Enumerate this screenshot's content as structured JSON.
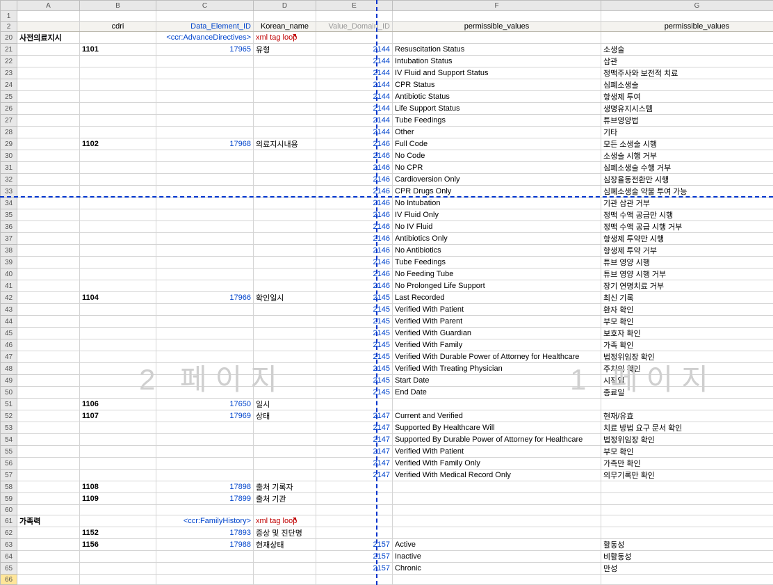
{
  "columns": [
    "A",
    "B",
    "C",
    "D",
    "E",
    "F",
    "G"
  ],
  "header": {
    "B": "cdri",
    "C": "Data_Element_ID",
    "D": "Korean_name",
    "E": "Value_Domain_ID",
    "F": "permissible_values",
    "G": "permissible_values"
  },
  "section1": {
    "A": "사전의료지시",
    "C": "<ccr:AdvanceDirectives>",
    "D": "xml tag loop"
  },
  "section2": {
    "A": "가족력",
    "C": "<ccr:FamilyHistory>",
    "D": "xml tag loop"
  },
  "watermark_left": "2 페이지",
  "watermark_right": "1 페이지",
  "rows": [
    {
      "n": 1
    },
    {
      "n": 2,
      "hdr": true
    },
    {
      "n": 20,
      "section": 1
    },
    {
      "n": 21,
      "B": "1101",
      "C": "17965",
      "D": "유형",
      "E": "2144",
      "F": "Resuscitation Status",
      "G": "소생술"
    },
    {
      "n": 22,
      "E": "2144",
      "F": "Intubation Status",
      "G": "삽관"
    },
    {
      "n": 23,
      "E": "2144",
      "F": "IV Fluid and Support Status",
      "G": "정맥주사와 보전적 치료"
    },
    {
      "n": 24,
      "E": "2144",
      "F": "CPR Status",
      "G": "심폐소생술"
    },
    {
      "n": 25,
      "E": "2144",
      "F": "Antibiotic Status",
      "G": "항생제 투여"
    },
    {
      "n": 26,
      "E": "2144",
      "F": "Life Support Status",
      "G": "생명유지시스템"
    },
    {
      "n": 27,
      "E": "2144",
      "F": "Tube Feedings",
      "G": "튜브영양법"
    },
    {
      "n": 28,
      "E": "2144",
      "F": "Other",
      "G": "기타"
    },
    {
      "n": 29,
      "B": "1102",
      "C": "17968",
      "D": "의료지시내용",
      "E": "2146",
      "F": "Full Code",
      "G": "모든 소생술 시행"
    },
    {
      "n": 30,
      "E": "2146",
      "F": "No Code",
      "G": "소생술 시행 거부"
    },
    {
      "n": 31,
      "E": "2146",
      "F": "No CPR",
      "G": "심폐소생술 수행 거부"
    },
    {
      "n": 32,
      "E": "2146",
      "F": "Cardioversion Only",
      "G": "심장율동전환만 시행"
    },
    {
      "n": 33,
      "E": "2146",
      "F": "CPR Drugs Only",
      "G": "심폐소생술 약물 투여 가능"
    },
    {
      "n": 34,
      "E": "2146",
      "F": "No Intubation",
      "G": "기관 삽관 거부"
    },
    {
      "n": 35,
      "E": "2146",
      "F": "IV Fluid Only",
      "G": "정맥 수액 공급만 시행"
    },
    {
      "n": 36,
      "E": "2146",
      "F": "No IV Fluid",
      "G": "정맥 수액 공급 시행 거부"
    },
    {
      "n": 37,
      "E": "2146",
      "F": "Antibiotics Only",
      "G": "항생제 투약만 시행"
    },
    {
      "n": 38,
      "E": "2146",
      "F": "No Antibiotics",
      "G": "항생제 투약 거부"
    },
    {
      "n": 39,
      "E": "2146",
      "F": "Tube Feedings",
      "G": "튜브 영양 시행"
    },
    {
      "n": 40,
      "E": "2146",
      "F": "No Feeding Tube",
      "G": "튜브 영양 시행 거부"
    },
    {
      "n": 41,
      "E": "2146",
      "F": "No Prolonged Life Support",
      "G": "장기 연명치료 거부"
    },
    {
      "n": 42,
      "B": "1104",
      "C": "17966",
      "D": "확인일시",
      "E": "2145",
      "F": "Last Recorded",
      "G": "최신 기록"
    },
    {
      "n": 43,
      "E": "2145",
      "F": "Verified With Patient",
      "G": "환자 확인"
    },
    {
      "n": 44,
      "E": "2145",
      "F": "Verified With Parent",
      "G": "부모 확인"
    },
    {
      "n": 45,
      "E": "2145",
      "F": "Verified With Guardian",
      "G": "보호자 확인"
    },
    {
      "n": 46,
      "E": "2145",
      "F": "Verified With Family",
      "G": "가족 확인"
    },
    {
      "n": 47,
      "E": "2145",
      "F": "Verified With Durable Power of Attorney for Healthcare",
      "G": "법정위임장 확인"
    },
    {
      "n": 48,
      "E": "2145",
      "F": "Verified With Treating Physician",
      "G": "주치의 확인"
    },
    {
      "n": 49,
      "E": "2145",
      "F": "Start Date",
      "G": "시작일"
    },
    {
      "n": 50,
      "E": "2145",
      "F": "End Date",
      "G": "종료일"
    },
    {
      "n": 51,
      "B": "1106",
      "C": "17650",
      "D": "일시"
    },
    {
      "n": 52,
      "B": "1107",
      "C": "17969",
      "D": "상태",
      "E": "2147",
      "F": "Current and Verified",
      "G": "현재/유효"
    },
    {
      "n": 53,
      "E": "2147",
      "F": "Supported By Healthcare Will",
      "G": "치료 방법 요구 문서 확인"
    },
    {
      "n": 54,
      "E": "2147",
      "F": "Supported By Durable Power of Attorney for Healthcare",
      "G": "법정위임장 확인"
    },
    {
      "n": 55,
      "E": "2147",
      "F": "Verified With Patient",
      "G": "부모 확인"
    },
    {
      "n": 56,
      "E": "2147",
      "F": "Verified With Family Only",
      "G": "가족만 확인"
    },
    {
      "n": 57,
      "E": "2147",
      "F": "Verified With Medical Record Only",
      "G": "의무기록만 확인"
    },
    {
      "n": 58,
      "B": "1108",
      "C": "17898",
      "D": "출처 기록자"
    },
    {
      "n": 59,
      "B": "1109",
      "C": "17899",
      "D": "출처 기관"
    },
    {
      "n": 60
    },
    {
      "n": 61,
      "section": 2
    },
    {
      "n": 62,
      "B": "1152",
      "C": "17893",
      "D": "증상 및 진단명"
    },
    {
      "n": 63,
      "B": "1156",
      "C": "17988",
      "D": "현재상태",
      "E": "2157",
      "F": "Active",
      "G": "활동성"
    },
    {
      "n": 64,
      "E": "2157",
      "F": "Inactive",
      "G": "비활동성"
    },
    {
      "n": 65,
      "E": "2157",
      "F": "Chronic",
      "G": "만성"
    },
    {
      "n": 66,
      "active": true
    }
  ]
}
